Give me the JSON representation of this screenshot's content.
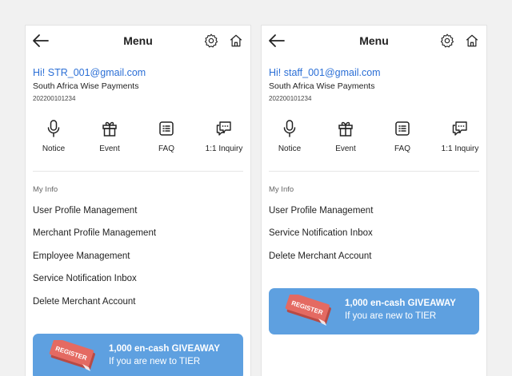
{
  "colors": {
    "accent_blue": "#2b6fd6",
    "banner_blue": "#5ea0e0",
    "banner_art": "#d9534f"
  },
  "panels": [
    {
      "title": "Menu",
      "greeting": "Hi! STR_001@gmail.com",
      "company": "South Africa Wise Payments",
      "code": "202200101234",
      "quick_links": [
        {
          "label": "Notice",
          "icon": "microphone-icon"
        },
        {
          "label": "Event",
          "icon": "gift-icon"
        },
        {
          "label": "FAQ",
          "icon": "list-icon"
        },
        {
          "label": "1:1 Inquiry",
          "icon": "chat-icon"
        }
      ],
      "section_label": "My Info",
      "menu_items": [
        "User Profile Management",
        "Merchant Profile Management",
        "Employee Management",
        "Service Notification Inbox",
        "Delete Merchant Account"
      ],
      "banner": {
        "art_text": "REGISTER",
        "line1": "1,000 en-cash GIVEAWAY",
        "line2": "If you are new to TIER"
      }
    },
    {
      "title": "Menu",
      "greeting": "Hi! staff_001@gmail.com",
      "company": "South Africa Wise Payments",
      "code": "202200101234",
      "quick_links": [
        {
          "label": "Notice",
          "icon": "microphone-icon"
        },
        {
          "label": "Event",
          "icon": "gift-icon"
        },
        {
          "label": "FAQ",
          "icon": "list-icon"
        },
        {
          "label": "1:1 Inquiry",
          "icon": "chat-icon"
        }
      ],
      "section_label": "My Info",
      "menu_items": [
        "User Profile Management",
        "Service Notification Inbox",
        "Delete Merchant Account"
      ],
      "banner": {
        "art_text": "REGISTER",
        "line1": "1,000 en-cash GIVEAWAY",
        "line2": "If you are new to TIER"
      }
    }
  ]
}
